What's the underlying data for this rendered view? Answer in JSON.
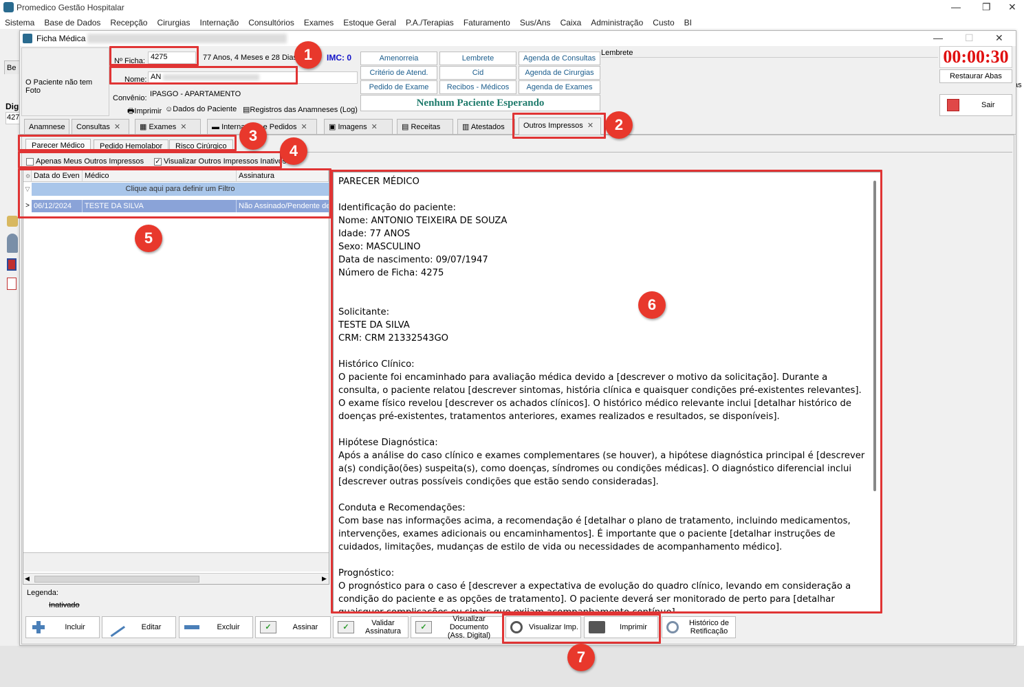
{
  "app": {
    "title": "Promedico Gestão Hospitalar"
  },
  "menu": [
    "Sistema",
    "Base de Dados",
    "Recepção",
    "Cirurgias",
    "Internação",
    "Consultórios",
    "Exames",
    "Estoque Geral",
    "P.A./Terapias",
    "Faturamento",
    "Sus/Ans",
    "Caixa",
    "Administração",
    "Custo",
    "BI"
  ],
  "window": {
    "title": "Ficha Médica"
  },
  "patient": {
    "photo_text": "O Paciente não tem Foto",
    "ficha_label": "Nº Ficha:",
    "ficha_value": "4275",
    "age": "77 Anos, 4 Meses e 28 Dias",
    "imc": "IMC: 0",
    "nome_label": "Nome:",
    "nome_value": "AN",
    "convenio_label": "Convênio:",
    "convenio_value": "IPASGO - APARTAMENTO"
  },
  "header_actions": {
    "imprimir": "Imprimir",
    "dados": "Dados do Paciente",
    "registros": "Registros das Anamneses (Log)"
  },
  "quick_buttons": [
    "Amenorreia",
    "Lembrete",
    "Agenda de Consultas",
    "Critério de Atend.",
    "Cid",
    "Agenda de Cirurgias",
    "Pedido de Exame",
    "Recibos - Médicos",
    "Agenda de Exames"
  ],
  "waiting": "Nenhum Paciente Esperando",
  "lembrete_label": "Lembrete",
  "timer": "00:00:30",
  "restaurar": "Restaurar Abas",
  "sair": "Sair",
  "left_fragments": {
    "be": "Be",
    "dig": "Dig",
    "num": "427",
    "as": "as"
  },
  "tabs": [
    "Anamnese",
    "Consultas",
    "Exames",
    "Internações e Pedidos",
    "Imagens",
    "Receitas",
    "Atestados",
    "Outros Impressos"
  ],
  "subtabs": [
    "Parecer Médico",
    "Pedido Hemolabor",
    "Risco Cirúrgico"
  ],
  "checks": {
    "apenas": "Apenas Meus Outros Impressos",
    "visualizar": "Visualizar Outros Impressos Inativos"
  },
  "grid": {
    "headers": [
      "Data do Even",
      "Médico",
      "Assinatura"
    ],
    "filter": "Clique aqui para definir um Filtro",
    "rows": [
      {
        "data": "06/12/2024",
        "medico": "TESTE DA SILVA",
        "assinatura": "Não Assinado/Pendente de"
      }
    ]
  },
  "legend": {
    "title": "Legenda:",
    "item": "Inativado"
  },
  "document": "PARECER MÉDICO\n\nIdentificação do paciente:\nNome: ANTONIO TEIXEIRA DE SOUZA\nIdade: 77 ANOS\nSexo: MASCULINO\nData de nascimento: 09/07/1947\nNúmero de Ficha: 4275\n\n\nSolicitante:\nTESTE DA SILVA\nCRM: CRM 21332543GO\n\nHistórico Clínico:\nO paciente foi encaminhado para avaliação médica devido a [descrever o motivo da solicitação]. Durante a consulta, o paciente relatou [descrever sintomas, história clínica e quaisquer condições pré-existentes relevantes]. O exame físico revelou [descrever os achados clínicos]. O histórico médico relevante inclui [detalhar histórico de doenças pré-existentes, tratamentos anteriores, exames realizados e resultados, se disponíveis].\n\nHipótese Diagnóstica:\nApós a análise do caso clínico e exames complementares (se houver), a hipótese diagnóstica principal é [descrever a(s) condição(ões) suspeita(s), como doenças, síndromes ou condições médicas]. O diagnóstico diferencial inclui [descrever outras possíveis condições que estão sendo consideradas].\n\nConduta e Recomendações:\nCom base nas informações acima, a recomendação é [detalhar o plano de tratamento, incluindo medicamentos, intervenções, exames adicionais ou encaminhamentos]. É importante que o paciente [detalhar instruções de cuidados, limitações, mudanças de estilo de vida ou necessidades de acompanhamento médico].\n\nPrognóstico:\nO prognóstico para o caso é [descrever a expectativa de evolução do quadro clínico, levando em consideração a condição do paciente e as opções de tratamento]. O paciente deverá ser monitorado de perto para [detalhar quaisquer complicações ou sinais que exijam acompanhamento contínuo].",
  "toolbar": {
    "incluir": "Incluir",
    "editar": "Editar",
    "excluir": "Excluir",
    "assinar": "Assinar",
    "validar": "Validar\nAssinatura",
    "visualizar_doc": "Visualizar Documento\n(Ass. Digital)",
    "visualizar_imp": "Visualizar Imp.",
    "imprimir": "Imprimir",
    "historico": "Histórico de\nRetificação"
  },
  "badges": [
    "1",
    "2",
    "3",
    "4",
    "5",
    "6",
    "7"
  ],
  "colors": {
    "annotation_red": "#e03434",
    "badge_red": "#e8382c",
    "timer_red": "#e01010",
    "link_blue": "#1a5c8c",
    "selection": "#8aa3d8"
  }
}
